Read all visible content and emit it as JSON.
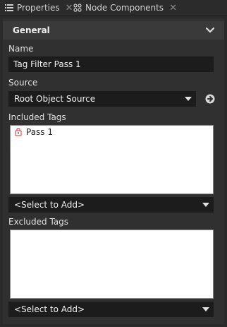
{
  "tabs": [
    {
      "label": "Properties",
      "icon": "list-icon"
    },
    {
      "label": "Node Components",
      "icon": "components-icon"
    }
  ],
  "section": {
    "title": "General"
  },
  "name": {
    "label": "Name",
    "value": "Tag Filter Pass 1"
  },
  "source": {
    "label": "Source",
    "value": "Root Object Source"
  },
  "included_tags": {
    "label": "Included Tags",
    "items": [
      {
        "label": "Pass 1",
        "icon": "tag-icon"
      }
    ],
    "add_label": "<Select to Add>"
  },
  "excluded_tags": {
    "label": "Excluded Tags",
    "items": [],
    "add_label": "<Select to Add>"
  },
  "colors": {
    "background": "#2a2a2a",
    "panel": "#303030",
    "header": "#3a3a3a",
    "field": "#1c1c1c",
    "tag_icon": "#d06060"
  }
}
